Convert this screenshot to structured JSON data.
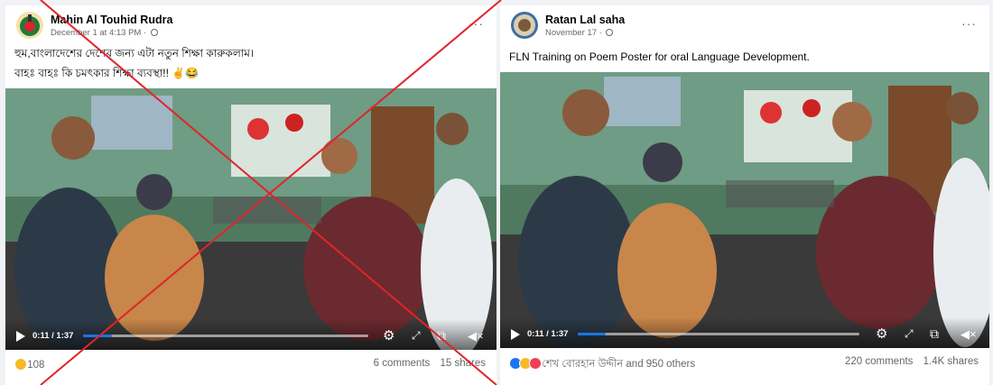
{
  "left_post": {
    "author": "Mahin Al Touhid Rudra",
    "date": "December 1 at 4:13 PM · ",
    "text_line1": "হুম,বাংলাদেশের দেশের জন্য এটা নতুন শিক্ষা কারুকলাম।",
    "text_line2": "বাহঃ বাহঃ কি চমৎকার শিক্ষা ব্যবস্থা!! ✌️😂",
    "video_time": "0:11 / 1:37",
    "progress": 0.1,
    "reaction_count": "108",
    "comments": "6 comments",
    "shares": "15 shares"
  },
  "right_post": {
    "author": "Ratan Lal saha",
    "date": "November 17 · ",
    "more": "···",
    "text": "FLN Training on Poem Poster for oral Language Development.",
    "video_time": "0:11 / 1:37",
    "progress": 0.1,
    "reaction_text": "শেখ বোরহান উদ্দীন and 950 others",
    "comments": "220 comments",
    "shares": "1.4K shares"
  },
  "icons": {
    "settings": "gear-icon",
    "fullscreen": "expand-icon",
    "pip": "picture-in-picture-icon",
    "volume": "muted-volume-icon"
  },
  "colors": {
    "cross": "#e0242a",
    "accent": "#1b74e4"
  }
}
